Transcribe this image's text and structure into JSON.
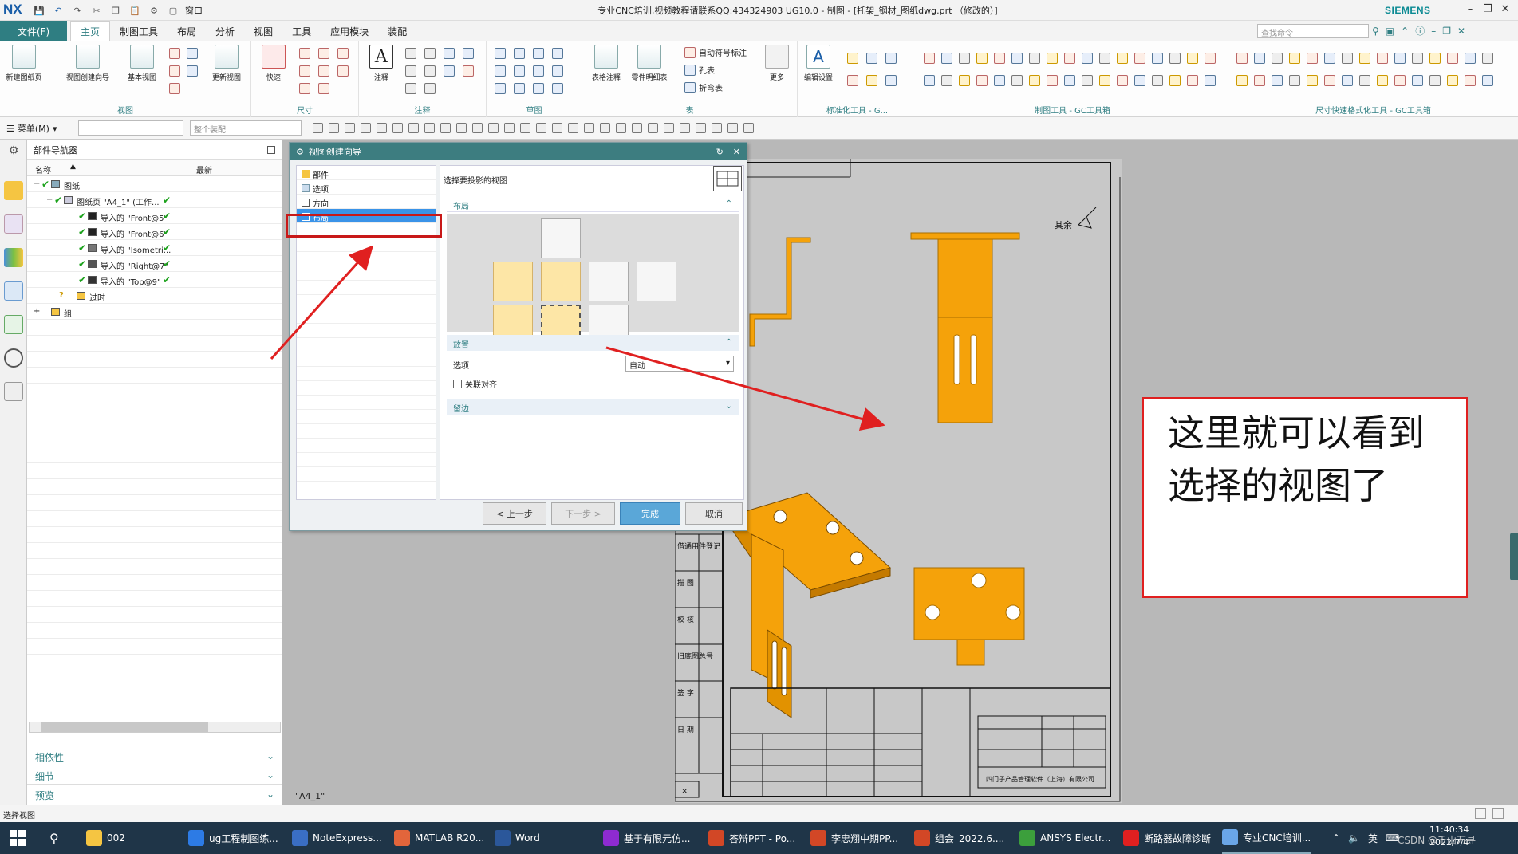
{
  "window": {
    "app_logo": "NX",
    "title": "专业CNC培训,视频教程请联系QQ:434324903 UG10.0 - 制图 - [托架_钢材_图纸dwg.prt （修改的）]",
    "brand": "SIEMENS",
    "window_menu": "窗口"
  },
  "menubar": {
    "file": "文件(F)",
    "items": [
      "主页",
      "制图工具",
      "布局",
      "分析",
      "视图",
      "工具",
      "应用模块",
      "装配"
    ],
    "search_placeholder": "查找命令"
  },
  "ribbon": {
    "groups": [
      "视图",
      "尺寸",
      "注释",
      "草图",
      "表",
      "标准化工具 - G...",
      "制图工具 - GC工具箱",
      "尺寸快速格式化工具 - GC工具箱"
    ],
    "buttons": [
      "新建图纸页",
      "视图创建向导",
      "基本视图",
      "更新视图",
      "快速",
      "注释",
      "表格注释",
      "零件明细表",
      "自动符号标注",
      "孔表",
      "折弯表",
      "更多",
      "编辑设置"
    ]
  },
  "toolbar2": {
    "menu_label": "菜单(M)",
    "filter_placeholder": "整个装配"
  },
  "part_navigator": {
    "title": "部件导航器",
    "col_name": "名称",
    "col_latest": "最新",
    "rows": [
      {
        "label": "图纸"
      },
      {
        "label": "图纸页 \"A4_1\" (工作..."
      },
      {
        "label": "导入的 \"Front@5\""
      },
      {
        "label": "导入的 \"Front@6\""
      },
      {
        "label": "导入的 \"Isometri..."
      },
      {
        "label": "导入的 \"Right@7\""
      },
      {
        "label": "导入的 \"Top@9\""
      },
      {
        "label": "过时"
      },
      {
        "label": "组"
      }
    ],
    "sections": [
      "相依性",
      "细节",
      "预览"
    ]
  },
  "dialog": {
    "title": "视图创建向导",
    "nav": [
      "部件",
      "选项",
      "方向",
      "布局"
    ],
    "selected_nav": "布局",
    "instruction": "选择要投影的视图",
    "section_layout": "布局",
    "section_place": "放置",
    "option_label": "选项",
    "option_value": "自动",
    "associative_label": "关联对齐",
    "section_margin": "留边",
    "btn_prev": "< 上一步",
    "btn_next": "下一步 >",
    "btn_finish": "完成",
    "btn_cancel": "取消"
  },
  "drawing": {
    "roughness_note": "其余",
    "sheet_label": "\"A4_1\"",
    "side_table": [
      "借通用件登记",
      "描 图",
      "校 核",
      "旧底图总号",
      "签 字",
      "日 期"
    ],
    "title_block": "四门子产品管理软件（上海）有限公司"
  },
  "callout": {
    "text_line1": "这里就可以看到",
    "text_line2": "选择的视图了"
  },
  "status": {
    "left": "选择视图"
  },
  "taskbar": {
    "items": [
      "002",
      "ug工程制图练...",
      "NoteExpress...",
      "MATLAB R20...",
      "Word",
      "基于有限元仿...",
      "答辩PPT - Po...",
      "李忠翔中期PP...",
      "组会_2022.6....",
      "ANSYS Electr...",
      "断路器故障诊断",
      "专业CNC培训..."
    ],
    "ime": "英",
    "time": "11:40:34",
    "date": "2022/7/4",
    "watermark": "CSDN @千山万寻"
  },
  "colors": {
    "accent": "#2f7e82",
    "part_orange": "#f5a20a",
    "annotation_red": "#e02020",
    "selection_blue": "#3a93e8"
  }
}
